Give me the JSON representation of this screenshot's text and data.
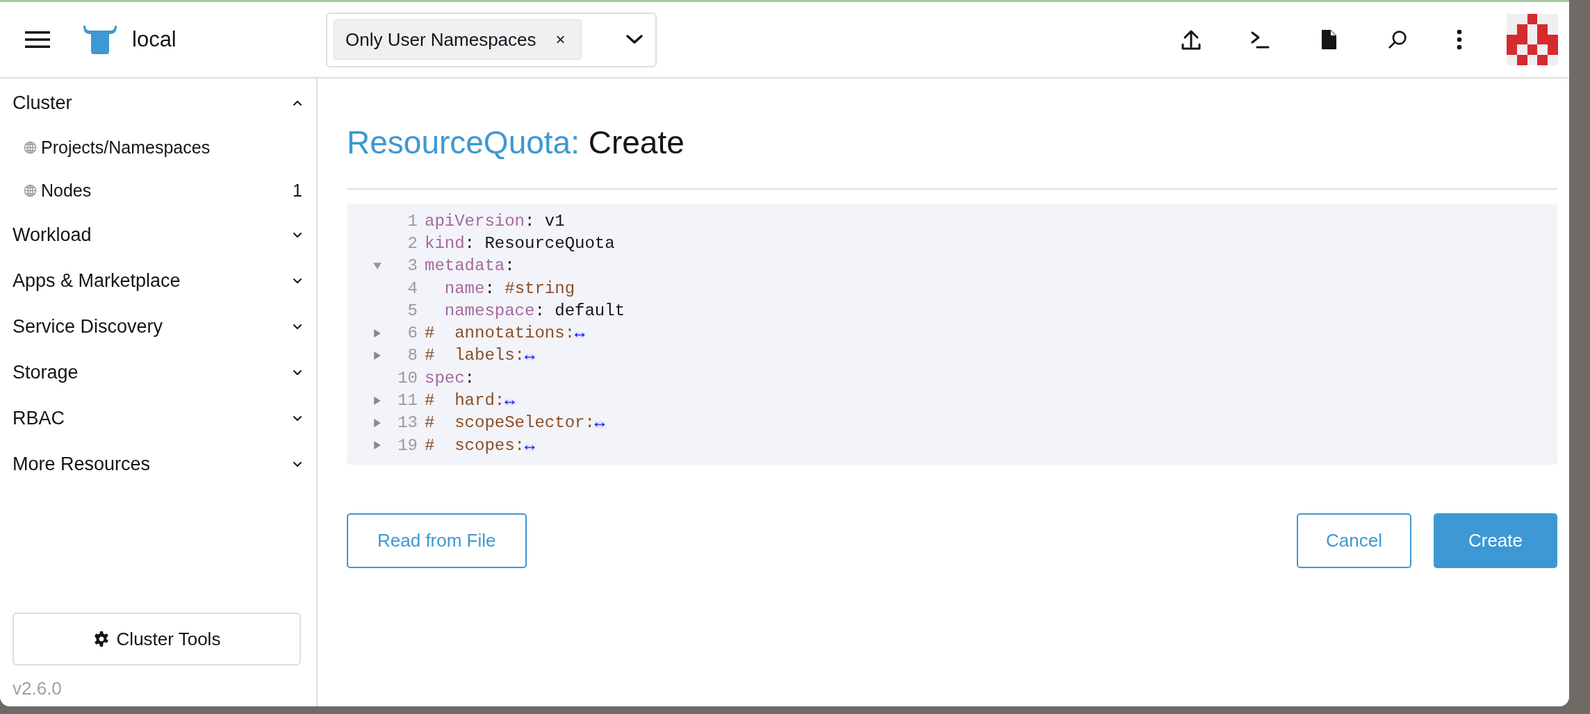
{
  "header": {
    "cluster_name": "local",
    "namespace_filter": {
      "chip": "Only User Namespaces",
      "chip_remove": "×"
    }
  },
  "sidebar": {
    "groups": [
      {
        "label": "Cluster",
        "expanded": true,
        "children": [
          {
            "label": "Projects/Namespaces"
          },
          {
            "label": "Nodes",
            "count": "1"
          }
        ]
      },
      {
        "label": "Workload",
        "expanded": false
      },
      {
        "label": "Apps & Marketplace",
        "expanded": false
      },
      {
        "label": "Service Discovery",
        "expanded": false
      },
      {
        "label": "Storage",
        "expanded": false
      },
      {
        "label": "RBAC",
        "expanded": false
      },
      {
        "label": "More Resources",
        "expanded": false
      }
    ],
    "cluster_tools_button": "Cluster Tools",
    "version": "v2.6.0"
  },
  "page": {
    "title_type": "ResourceQuota:",
    "title_action": "Create"
  },
  "editor": {
    "lines": [
      {
        "number": "1",
        "tokens": [
          {
            "kind": "key",
            "text": "apiVersion"
          },
          {
            "kind": "plain",
            "text": ": v1"
          }
        ]
      },
      {
        "number": "2",
        "tokens": [
          {
            "kind": "key",
            "text": "kind"
          },
          {
            "kind": "plain",
            "text": ": ResourceQuota"
          }
        ]
      },
      {
        "number": "3",
        "expanded": true,
        "tokens": [
          {
            "kind": "key",
            "text": "metadata"
          },
          {
            "kind": "plain",
            "text": ":"
          }
        ]
      },
      {
        "number": "4",
        "tokens": [
          {
            "kind": "key",
            "text": "  name"
          },
          {
            "kind": "plain",
            "text": ": "
          },
          {
            "kind": "comment",
            "text": "#string"
          }
        ]
      },
      {
        "number": "5",
        "tokens": [
          {
            "kind": "key",
            "text": "  namespace"
          },
          {
            "kind": "plain",
            "text": ": default"
          }
        ]
      },
      {
        "number": "6",
        "expanded": false,
        "tokens": [
          {
            "kind": "comment",
            "text": "#  annotations:"
          },
          {
            "kind": "folded",
            "text": "↔"
          }
        ]
      },
      {
        "number": "8",
        "expanded": false,
        "tokens": [
          {
            "kind": "comment",
            "text": "#  labels:"
          },
          {
            "kind": "folded",
            "text": "↔"
          }
        ]
      },
      {
        "number": "10",
        "tokens": [
          {
            "kind": "key",
            "text": "spec"
          },
          {
            "kind": "plain",
            "text": ":"
          }
        ]
      },
      {
        "number": "11",
        "expanded": false,
        "tokens": [
          {
            "kind": "comment",
            "text": "#  hard:"
          },
          {
            "kind": "folded",
            "text": "↔"
          }
        ]
      },
      {
        "number": "13",
        "expanded": false,
        "tokens": [
          {
            "kind": "comment",
            "text": "#  scopeSelector:"
          },
          {
            "kind": "folded",
            "text": "↔"
          }
        ]
      },
      {
        "number": "19",
        "expanded": false,
        "tokens": [
          {
            "kind": "comment",
            "text": "#  scopes:"
          },
          {
            "kind": "folded",
            "text": "↔"
          }
        ]
      }
    ]
  },
  "buttons": {
    "read_from_file": "Read from File",
    "cancel": "Cancel",
    "create": "Create"
  }
}
